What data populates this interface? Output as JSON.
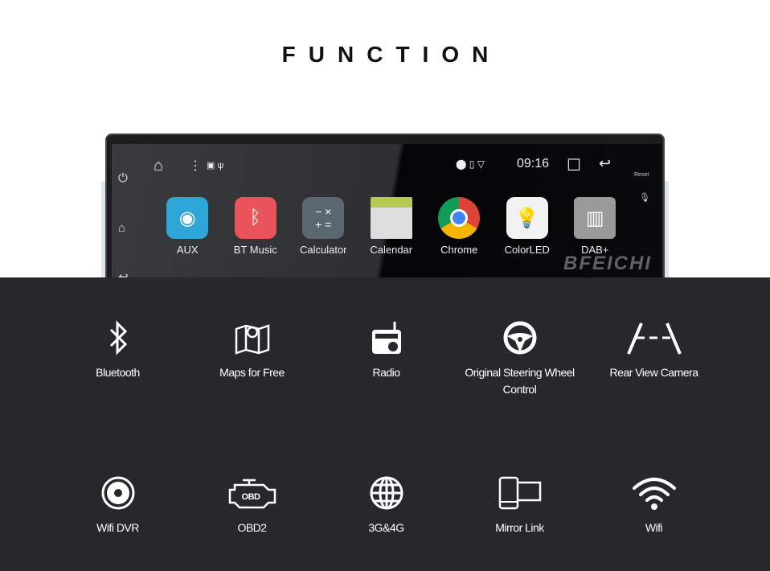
{
  "title": "FUNCTION",
  "device": {
    "time": "09:16",
    "reset_label": "Reset",
    "brand": "BFEICHI",
    "apps": [
      {
        "label": "AUX",
        "color": "#2fa6d8"
      },
      {
        "label": "BT Music",
        "color": "#e8545a"
      },
      {
        "label": "Calculator",
        "color": "#5b6770"
      },
      {
        "label": "Calendar",
        "color": "#b5c850"
      },
      {
        "label": "Chrome",
        "color": "#db4437"
      },
      {
        "label": "ColorLED",
        "color": "#f2f2f2"
      },
      {
        "label": "DAB+",
        "color": "#9a9a9a"
      }
    ]
  },
  "features": [
    {
      "label": "Bluetooth",
      "icon": "bluetooth-icon"
    },
    {
      "label": "Maps for Free",
      "icon": "map-icon"
    },
    {
      "label": "Radio",
      "icon": "radio-icon"
    },
    {
      "label": "Original Steering Wheel Control",
      "icon": "steering-wheel-icon"
    },
    {
      "label": "Rear View Camera",
      "icon": "rear-camera-icon"
    },
    {
      "label": "Wifi DVR",
      "icon": "camera-shutter-icon"
    },
    {
      "label": "OBD2",
      "icon": "obd-engine-icon"
    },
    {
      "label": "3G&4G",
      "icon": "globe-icon"
    },
    {
      "label": "Mirror Link",
      "icon": "mirror-link-icon"
    },
    {
      "label": "Wifi",
      "icon": "wifi-icon"
    }
  ]
}
